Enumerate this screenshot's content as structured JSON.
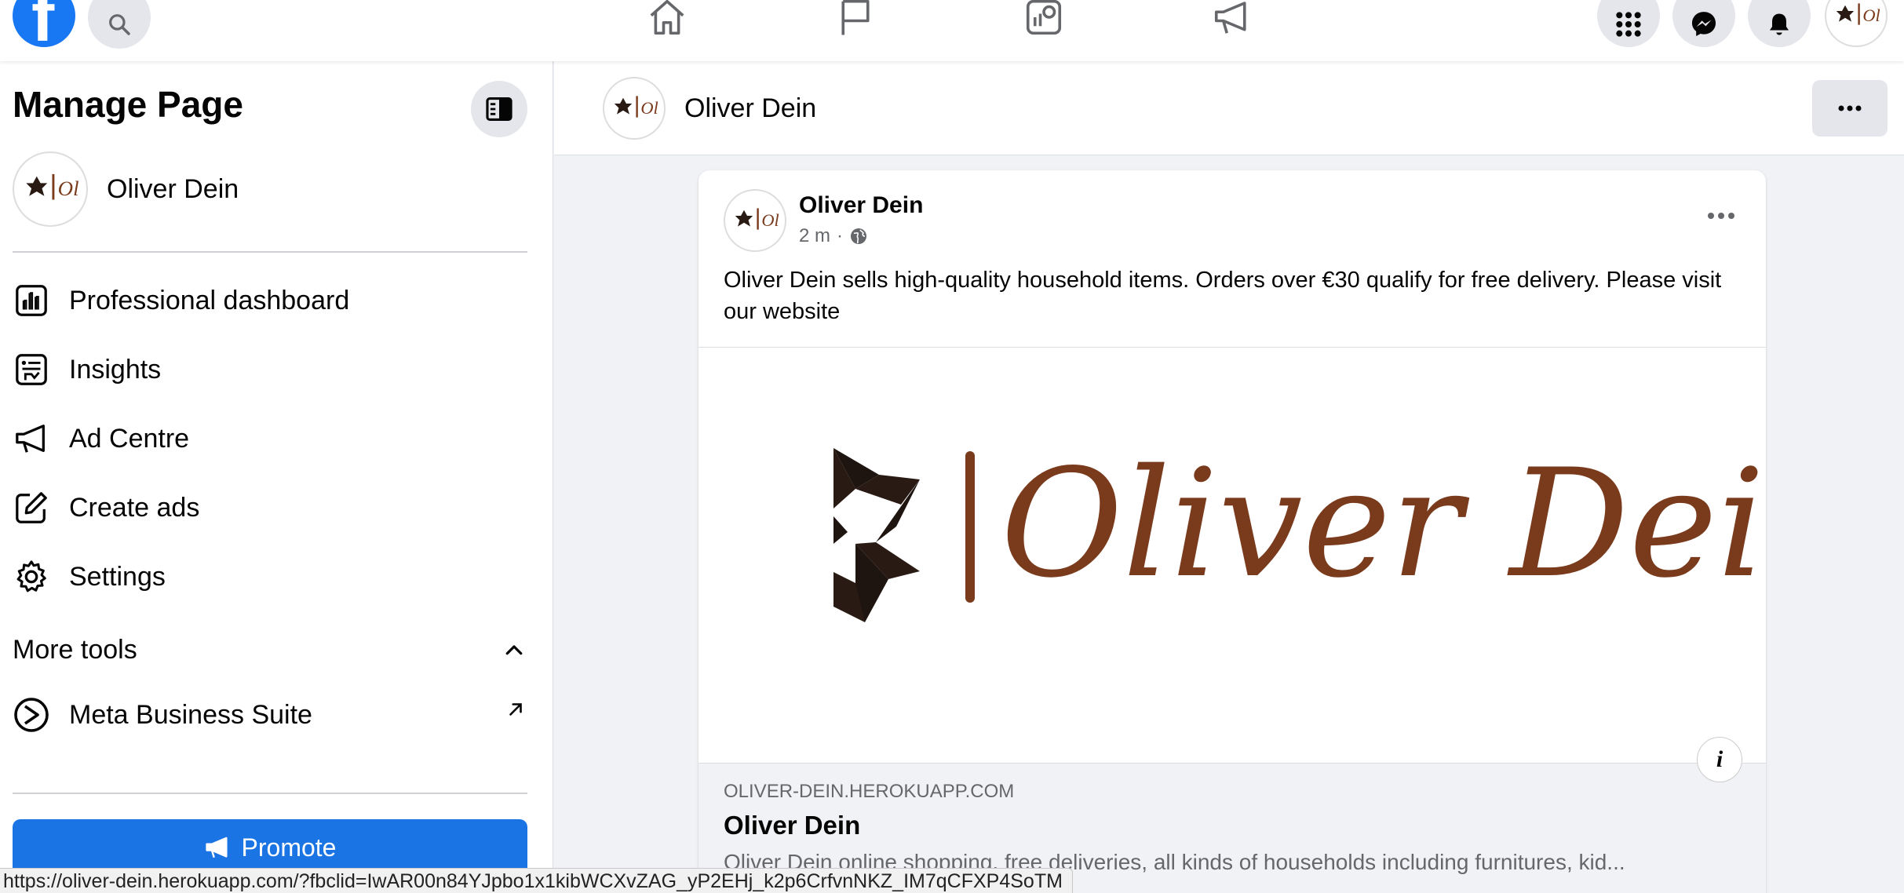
{
  "topbar": {
    "logo_letter": "f",
    "icons": [
      "search-icon",
      "home-icon",
      "flag-icon",
      "dashboard-icon",
      "megaphone-icon",
      "menu-grid-icon",
      "messenger-icon",
      "bell-icon"
    ]
  },
  "sidebar": {
    "title": "Manage Page",
    "page_name": "Oliver Dein",
    "items": [
      {
        "label": "Professional dashboard",
        "icon": "chart-icon"
      },
      {
        "label": "Insights",
        "icon": "insights-icon"
      },
      {
        "label": "Ad Centre",
        "icon": "megaphone-icon"
      },
      {
        "label": "Create ads",
        "icon": "pencil-icon"
      },
      {
        "label": "Settings",
        "icon": "gear-icon"
      }
    ],
    "more_tools_label": "More tools",
    "meta_business_suite": "Meta Business Suite",
    "promote_label": "Promote"
  },
  "page_header": {
    "name": "Oliver Dein"
  },
  "post": {
    "author": "Oliver Dein",
    "time": "2 m",
    "separator": "·",
    "text": "Oliver Dein sells high-quality household items. Orders over €30 qualify for free delivery. Please visit our website",
    "image_logo_text": "Oliver Dein",
    "link": {
      "domain": "OLIVER-DEIN.HEROKUAPP.COM",
      "title": "Oliver Dein",
      "description": "Oliver Dein online shopping, free deliveries, all kinds of households including furnitures, kid..."
    },
    "info_label": "i"
  },
  "status_bar": {
    "url": "https://oliver-dein.herokuapp.com/?fbclid=IwAR00n84YJpbo1x1kibWCXvZAG_yP2EHj_k2p6CrfvnNKZ_IM7qCFXP4SoTM"
  },
  "colors": {
    "facebook_blue": "#1877f2",
    "promote_blue": "#1b74e4",
    "logo_brown": "#7a3a1c",
    "logo_dark": "#2a1a14"
  }
}
